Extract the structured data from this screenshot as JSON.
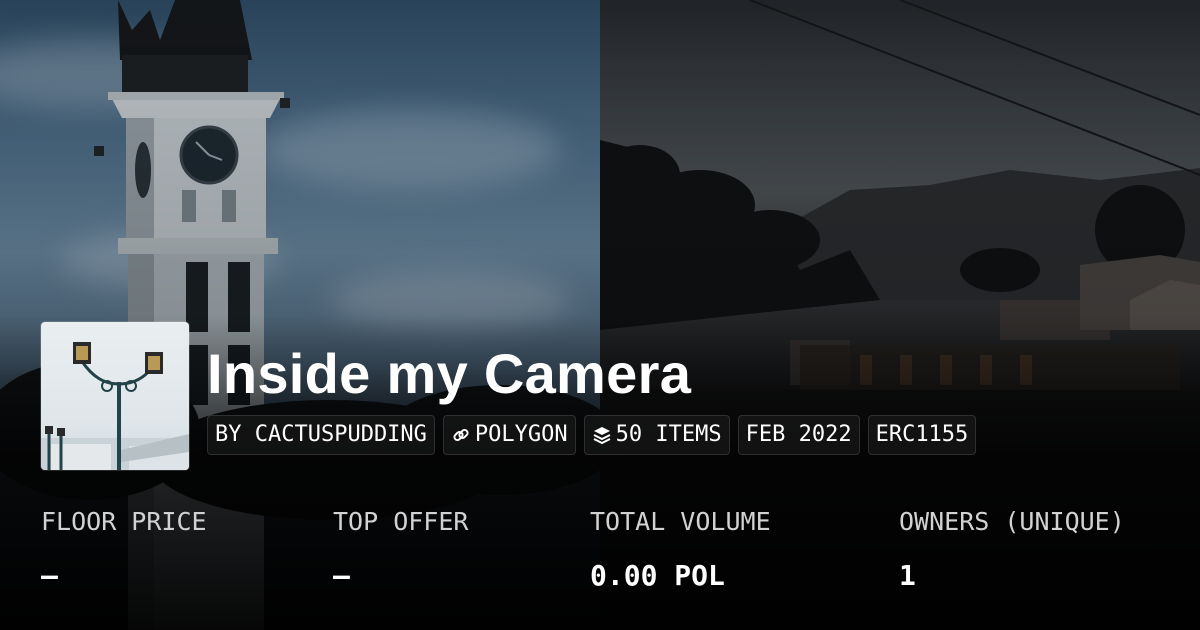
{
  "collection": {
    "title": "Inside my Camera",
    "chips": [
      {
        "label": "BY CACTUSPUDDING",
        "icon": ""
      },
      {
        "label": "POLYGON",
        "icon": "link-icon"
      },
      {
        "label": "50 ITEMS",
        "icon": "layers-icon"
      },
      {
        "label": "FEB 2022",
        "icon": ""
      },
      {
        "label": "ERC1155",
        "icon": ""
      }
    ]
  },
  "stats": [
    {
      "label": "FLOOR PRICE",
      "value": "–"
    },
    {
      "label": "TOP OFFER",
      "value": "–"
    },
    {
      "label": "TOTAL VOLUME",
      "value": "0.00 POL"
    },
    {
      "label": "OWNERS (UNIQUE)",
      "value": "1"
    }
  ],
  "theme": {
    "text": "#ffffff",
    "label": "#d2d2d2",
    "chip_bg": "#1e1e1e"
  }
}
